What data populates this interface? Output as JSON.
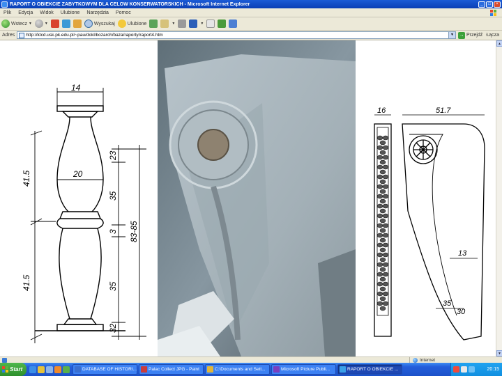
{
  "window": {
    "title": "RAPORT O OBIEKCIE ZABYTKOWYM DLA CELÓW KONSERWATORSKICH - Microsoft Internet Explorer",
    "buttons": {
      "minimize": "_",
      "maximize": "□",
      "close": "×"
    }
  },
  "menu": [
    "Plik",
    "Edycja",
    "Widok",
    "Ulubione",
    "Narzędzia",
    "Pomoc"
  ],
  "toolbar": {
    "back": "Wstecz",
    "search": "Wyszukaj",
    "favorites": "Ulubione"
  },
  "address": {
    "label": "Adres",
    "url": "http://ktcd.usk.pk.edu.pl/~pau/dokl/bozarch/baza/raporty/raport4.htm",
    "go": "Przejdź",
    "links": "Łącza"
  },
  "status": {
    "zone": "Internet"
  },
  "taskbar": {
    "start": "Start",
    "tasks": [
      {
        "label": "DATABASE OF HISTORI...",
        "active": false,
        "color": "#3a6fd0"
      },
      {
        "label": "Palac Collect JPG - Paint",
        "active": false,
        "color": "#c93c3c"
      },
      {
        "label": "C:\\Documents and Sett...",
        "active": false,
        "color": "#e0b53a"
      },
      {
        "label": "Microsoft Picture Publi...",
        "active": false,
        "color": "#7a3fbf"
      },
      {
        "label": "RAPORT O OBIEKCIE ...",
        "active": true,
        "color": "#3aa0e8"
      }
    ],
    "clock": "20:15"
  },
  "drawings": {
    "baluster": {
      "top_width": "14",
      "mid_width": "20",
      "upper_height": "41.5",
      "lower_height": "41.5",
      "d1": "23",
      "d2": "35",
      "d3": "3",
      "d4": "35",
      "d5": "32",
      "total": "83-85"
    },
    "panel": {
      "left_width": "16",
      "right_width": "51.7",
      "depth": "13",
      "a": "35",
      "b": "30"
    }
  }
}
